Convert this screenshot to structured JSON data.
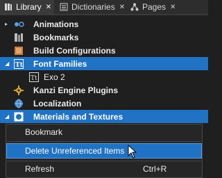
{
  "tabs": [
    {
      "label": "Library",
      "icon": "library-icon",
      "active": true
    },
    {
      "label": "Dictionaries",
      "icon": "dictionaries-icon",
      "active": false
    },
    {
      "label": "Pages",
      "icon": "pages-icon",
      "active": false
    }
  ],
  "close_glyph": "✕",
  "tree": {
    "items": [
      {
        "label": "Animations",
        "icon": "animations-icon",
        "expanded": false
      },
      {
        "label": "Bookmarks",
        "icon": "bookmarks-icon",
        "expanded": false
      },
      {
        "label": "Build Configurations",
        "icon": "build-configurations-icon",
        "expanded": false
      },
      {
        "label": "Font Families",
        "icon": "font-families-icon",
        "expanded": true,
        "selected": true
      },
      {
        "label": "Exo 2",
        "icon": "font-icon",
        "child": true
      },
      {
        "label": "Kanzi Engine Plugins",
        "icon": "plugins-icon",
        "expanded": false
      },
      {
        "label": "Localization",
        "icon": "localization-icon",
        "expanded": false
      },
      {
        "label": "Materials and Textures",
        "icon": "materials-icon",
        "expanded": true,
        "selected": true
      }
    ],
    "collapsed_arrow": "▸",
    "expanded_arrow": "◢"
  },
  "context_menu": {
    "items": [
      {
        "label": "Bookmark",
        "shortcut": ""
      },
      {
        "label": "Delete Unreferenced Items",
        "shortcut": "",
        "hover": true
      },
      {
        "label": "Refresh",
        "shortcut": "Ctrl+R"
      }
    ]
  },
  "colors": {
    "selection": "#1f72c4",
    "background": "#1f1f1f",
    "tab_bar": "#2d2d2d"
  }
}
